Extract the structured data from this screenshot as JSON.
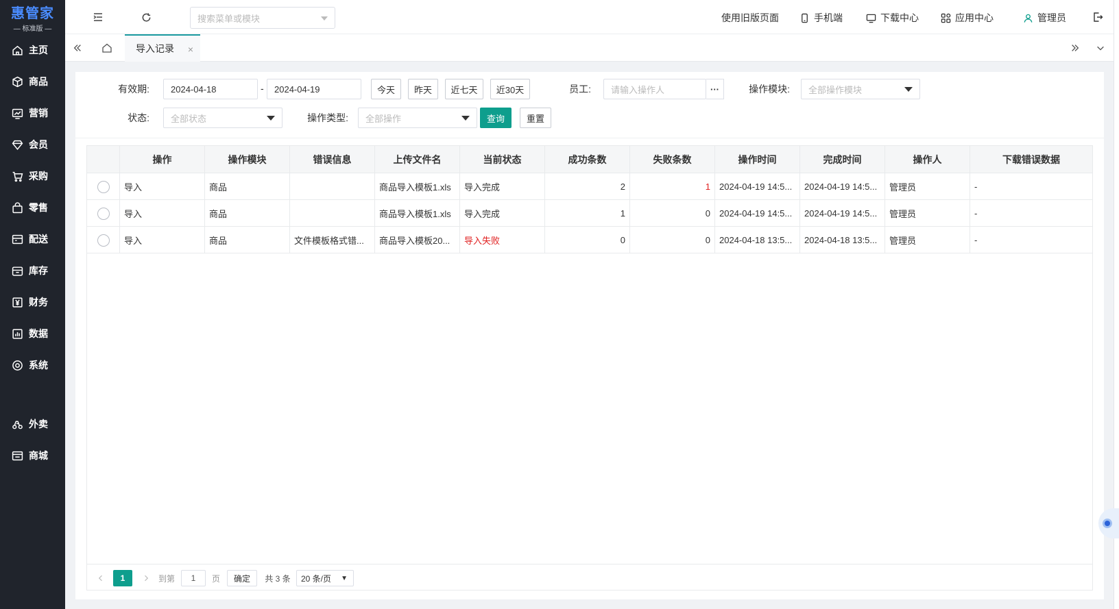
{
  "brand": {
    "name": "惠管家",
    "edition": "— 标准版 —"
  },
  "sidebar": {
    "items": [
      {
        "label": "主页",
        "icon": "home-icon"
      },
      {
        "label": "商品",
        "icon": "box-icon"
      },
      {
        "label": "营销",
        "icon": "chart-icon"
      },
      {
        "label": "会员",
        "icon": "diamond-icon"
      },
      {
        "label": "采购",
        "icon": "cart-icon"
      },
      {
        "label": "零售",
        "icon": "bag-icon"
      },
      {
        "label": "配送",
        "icon": "truck-icon"
      },
      {
        "label": "库存",
        "icon": "warehouse-icon"
      },
      {
        "label": "财务",
        "icon": "yen-icon"
      },
      {
        "label": "数据",
        "icon": "bar-chart-icon"
      },
      {
        "label": "系统",
        "icon": "settings-icon"
      },
      {
        "label": "外卖",
        "icon": "delivery-icon"
      },
      {
        "label": "商城",
        "icon": "store-icon"
      }
    ]
  },
  "topbar": {
    "search_placeholder": "搜索菜单或模块",
    "old_version": "使用旧版页面",
    "mobile": "手机端",
    "download_center": "下载中心",
    "app_center": "应用中心",
    "user": "管理员"
  },
  "tabs": {
    "active": "导入记录",
    "close": "×"
  },
  "filters": {
    "validity_label": "有效期:",
    "date_from": "2024-04-18",
    "date_sep": "-",
    "date_to": "2024-04-19",
    "quick": [
      "今天",
      "昨天",
      "近七天",
      "近30天"
    ],
    "employee_label": "员工:",
    "employee_placeholder": "请输入操作人",
    "employee_more": "···",
    "module_label": "操作模块:",
    "module_value": "全部操作模块",
    "status_label": "状态:",
    "status_value": "全部状态",
    "optype_label": "操作类型:",
    "optype_value": "全部操作",
    "query_btn": "查询",
    "reset_btn": "重置"
  },
  "table": {
    "columns": [
      "操作",
      "操作模块",
      "错误信息",
      "上传文件名",
      "当前状态",
      "成功条数",
      "失败条数",
      "操作时间",
      "完成时间",
      "操作人",
      "下载错误数据"
    ],
    "rows": [
      [
        "导入",
        "商品",
        "",
        "商品导入模板1.xls",
        "导入完成",
        "2",
        "1",
        "2024-04-19 14:5...",
        "2024-04-19 14:5...",
        "管理员",
        "-"
      ],
      [
        "导入",
        "商品",
        "",
        "商品导入模板1.xls",
        "导入完成",
        "1",
        "0",
        "2024-04-19 14:5...",
        "2024-04-19 14:5...",
        "管理员",
        "-"
      ],
      [
        "导入",
        "商品",
        "文件模板格式错...",
        "商品导入模板20...",
        "导入失败",
        "0",
        "0",
        "2024-04-18 13:5...",
        "2024-04-18 13:5...",
        "管理员",
        "-"
      ]
    ]
  },
  "pagination": {
    "current": "1",
    "goto_label": "到第",
    "goto_value": "1",
    "page_label": "页",
    "confirm": "确定",
    "total": "共 3 条",
    "page_size": "20 条/页"
  },
  "colors": {
    "accent": "#0e9e8d",
    "sidebar_bg": "#20242c",
    "error": "#e02020",
    "brand": "#4a8cff"
  }
}
